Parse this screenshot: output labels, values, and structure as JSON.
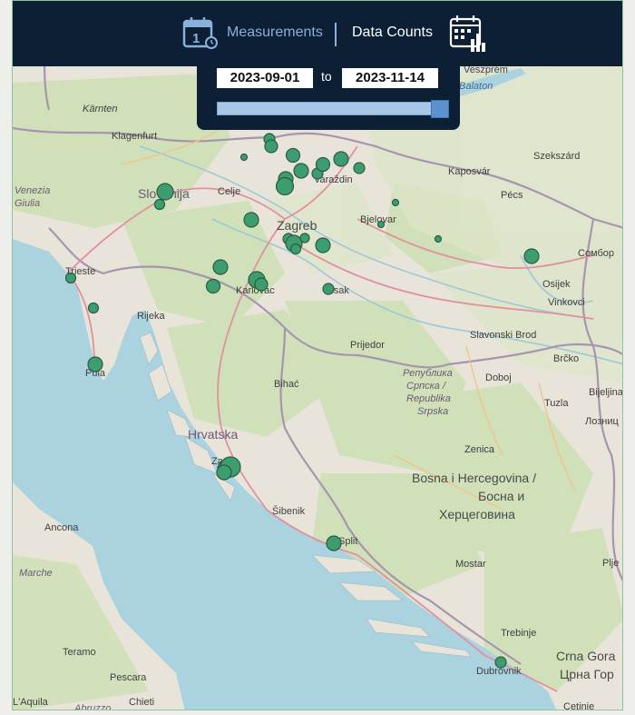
{
  "header": {
    "measurements_label": "Measurements",
    "data_counts_label": "Data Counts",
    "calendar_icon_day": "1",
    "calendar_icon": "calendar-clock-icon",
    "counts_icon": "calendar-chart-icon"
  },
  "date_range": {
    "from": "2023-09-01",
    "to_label": "to",
    "to": "2023-11-14",
    "slider_fraction": 1.0
  },
  "colors": {
    "header_bg": "#0c1f35",
    "accent": "#8ab0dc",
    "marker_fill": "#3e9d6e",
    "sea": "#aad3df",
    "land": "#e8e4da"
  },
  "map_labels": {
    "karnten": "Kärnten",
    "klagenfurt": "Klagenfurt",
    "venezia": "Venezia",
    "giulia": "Giulia",
    "slovenija": "Slovenija",
    "celje": "Celje",
    "varazdin": "Varaždin",
    "zagreb": "Zagreb",
    "bjelovar": "Bjelovar",
    "trieste": "Trieste",
    "rijeka": "Rijeka",
    "karlovac": "Karlovac",
    "sisak": "Sisak",
    "pula": "Pula",
    "prijedor": "Prijedor",
    "bihac": "Bihać",
    "hrvatska": "Hrvatska",
    "zadar": "Zadar",
    "sibenik": "Šibenik",
    "split": "Split",
    "ancona": "Ancona",
    "marche": "Marche",
    "teramo": "Teramo",
    "pescara": "Pescara",
    "aquila": "L'Aquila",
    "abruzzo": "Abruzzo",
    "chieti": "Chieti",
    "veszprem": "Veszprém",
    "balaton": "Balaton",
    "kaposvar": "Kaposvár",
    "szekszard": "Szekszárd",
    "pecs": "Pécs",
    "sombor": "Сомбор",
    "osijek": "Osijek",
    "vinkovci": "Vinkovci",
    "slavonski_brod": "Slavonski Brod",
    "brcko": "Brčko",
    "republika1": "Република",
    "republika2": "Српска /",
    "republika3": "Republika",
    "republika4": "Srpska",
    "doboj": "Doboj",
    "tuzla": "Tuzla",
    "bijeljina": "Bijeljina",
    "loznica": "Лозниц",
    "zenica": "Zenica",
    "bih1": "Bosna i Hercegovina /",
    "bih2": "Босна и",
    "bih3": "Херцеговина",
    "mostar": "Mostar",
    "pljevlja": "Plje",
    "trebinje": "Trebinje",
    "dubrovnik": "Dubrovnik",
    "cg1": "Crna Gora",
    "cg2": "Црна Гор",
    "cetinje": "Cetinje"
  }
}
